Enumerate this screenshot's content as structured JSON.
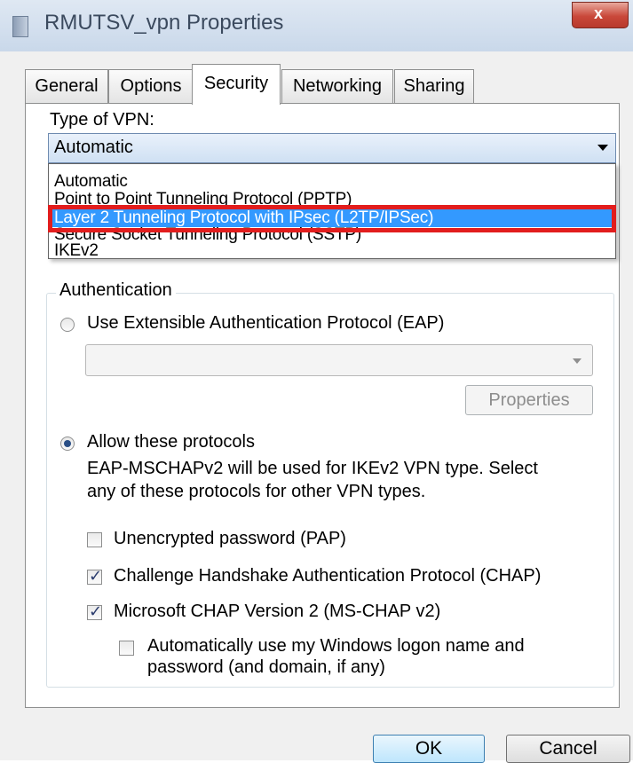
{
  "window": {
    "title": "RMUTSV_vpn Properties",
    "close_glyph": "x"
  },
  "tabs": [
    {
      "label": "General"
    },
    {
      "label": "Options"
    },
    {
      "label": "Security"
    },
    {
      "label": "Networking"
    },
    {
      "label": "Sharing"
    }
  ],
  "active_tab": "Security",
  "vpn": {
    "label": "Type of VPN:",
    "selected": "Automatic",
    "options": [
      "Automatic",
      "Point to Point Tunneling Protocol (PPTP)",
      "Layer 2 Tunneling Protocol with IPsec (L2TP/IPSec)",
      "Secure Socket Tunneling Protocol (SSTP)",
      "IKEv2"
    ],
    "highlighted_index": 2
  },
  "auth": {
    "legend": "Authentication",
    "eap_radio_label": "Use Extensible Authentication Protocol (EAP)",
    "eap_selected": false,
    "properties_button": "Properties",
    "allow_radio_label": "Allow these protocols",
    "allow_selected": true,
    "note_line1": "EAP-MSCHAPv2 will be used for IKEv2 VPN type. Select",
    "note_line2": "any of these protocols for other VPN types.",
    "checks": [
      {
        "label": "Unencrypted password (PAP)",
        "checked": false
      },
      {
        "label": "Challenge Handshake Authentication Protocol (CHAP)",
        "checked": true
      },
      {
        "label": "Microsoft CHAP Version 2 (MS-CHAP v2)",
        "checked": true
      }
    ],
    "auto_logon_line1": "Automatically use my Windows logon name and",
    "auto_logon_line2": "password (and domain, if any)",
    "auto_logon_checked": false
  },
  "footer": {
    "ok": "OK",
    "cancel": "Cancel"
  },
  "colors": {
    "highlight_border": "#e21d1d",
    "selection_bg": "#3399ff"
  }
}
